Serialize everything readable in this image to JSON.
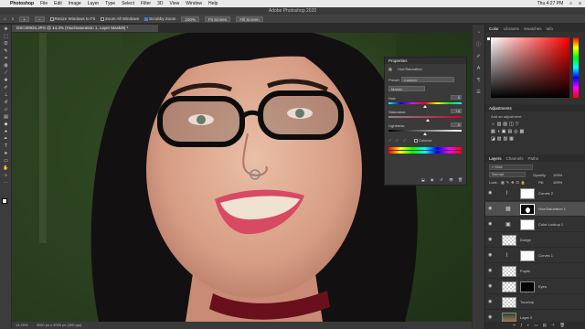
{
  "menubar": {
    "apple_icon": "apple-icon",
    "items": [
      "Photoshop",
      "File",
      "Edit",
      "Image",
      "Layer",
      "Type",
      "Select",
      "Filter",
      "3D",
      "View",
      "Window",
      "Help"
    ],
    "clock": "Thu 4:27 PM"
  },
  "window_title": "Adobe Photoshop 2020",
  "options": {
    "resize_windows": "Resize Windows to Fit",
    "zoom_all_windows": "Zoom All Windows",
    "scrubby_zoom": "Scrubby Zoom",
    "zoom_level": "100%",
    "fit_screen": "Fit Screen",
    "fill_screen": "Fill Screen"
  },
  "document_tab": "DSC00933.JPG @ 14.3% (Hue/Saturation 1, Layer Mask/8) *",
  "status": "14.29%",
  "status_doc": "3000 px x 2000 px (300 ppi)",
  "right_tabs_top": [
    "Color",
    "Libraries",
    "Swatches",
    "Info"
  ],
  "adjustments": {
    "title": "Adjustments",
    "subtitle": "Add an adjustment"
  },
  "layers": {
    "tabs": [
      "Layers",
      "Channels",
      "Paths"
    ],
    "kind": "Kind",
    "blend": "Normal",
    "opacity_label": "Opacity:",
    "opacity": "100%",
    "lock_label": "Lock:",
    "fill_label": "Fill:",
    "fill": "100%",
    "rows": [
      {
        "name": "Curves 2",
        "type": "adjustment"
      },
      {
        "name": "Hue/Saturation 1",
        "type": "adjustment"
      },
      {
        "name": "Color Lookup 1",
        "type": "adjustment"
      },
      {
        "name": "Dodge",
        "type": "pixel"
      },
      {
        "name": "Curves 1",
        "type": "adjustment"
      },
      {
        "name": "Pupils",
        "type": "pixel"
      },
      {
        "name": "Eyes",
        "type": "pixel"
      },
      {
        "name": "Touchup",
        "type": "pixel"
      },
      {
        "name": "Layer 0",
        "type": "photo"
      }
    ]
  },
  "properties": {
    "tabs": [
      "Properties"
    ],
    "panel_title": "Hue/Saturation",
    "preset_label": "Preset:",
    "preset_value": "Custom",
    "channel": "Master",
    "hue_label": "Hue:",
    "hue_value": "0",
    "saturation_label": "Saturation:",
    "saturation_value": "+4",
    "lightness_label": "Lightness:",
    "lightness_value": "0",
    "colorize_label": "Colorize"
  }
}
